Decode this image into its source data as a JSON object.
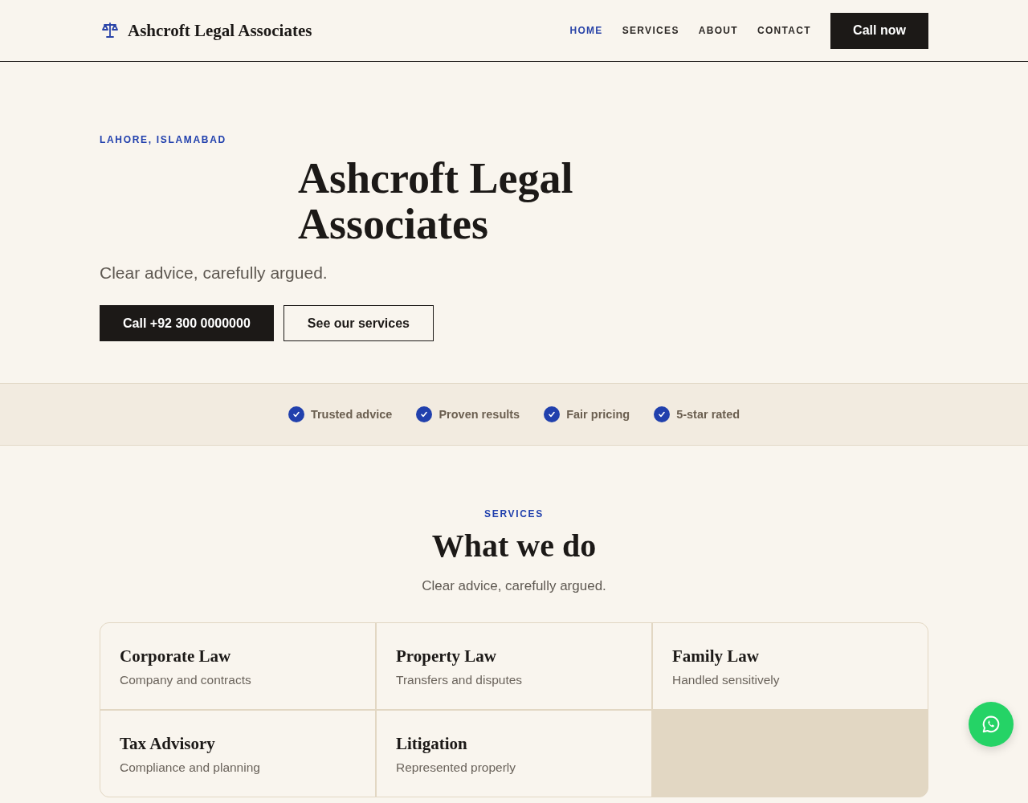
{
  "header": {
    "brand": "Ashcroft Legal Associates",
    "nav": [
      {
        "label": "HOME",
        "selected": true
      },
      {
        "label": "SERVICES",
        "selected": false
      },
      {
        "label": "ABOUT",
        "selected": false
      },
      {
        "label": "CONTACT",
        "selected": false
      }
    ],
    "cta": "Call now"
  },
  "hero": {
    "eyebrow": "LAHORE, ISLAMABAD",
    "title": "Ashcroft Legal Associates",
    "tagline": "Clear advice, carefully argued.",
    "buttons": [
      {
        "label": "Call +92 300 0000000",
        "kind": "primary"
      },
      {
        "label": "See our services",
        "kind": "outline"
      }
    ]
  },
  "highlights": [
    "Trusted advice",
    "Proven results",
    "Fair pricing",
    "5-star rated"
  ],
  "services": {
    "eyebrow": "SERVICES",
    "title": "What we do",
    "subtitle": "Clear advice, carefully argued.",
    "cards": [
      {
        "title": "Corporate Law",
        "description": "Company and contracts"
      },
      {
        "title": "Property Law",
        "description": "Transfers and disputes"
      },
      {
        "title": "Family Law",
        "description": "Handled sensitively"
      },
      {
        "title": "Tax Advisory",
        "description": "Compliance and planning"
      },
      {
        "title": "Litigation",
        "description": "Represented properly"
      }
    ]
  }
}
